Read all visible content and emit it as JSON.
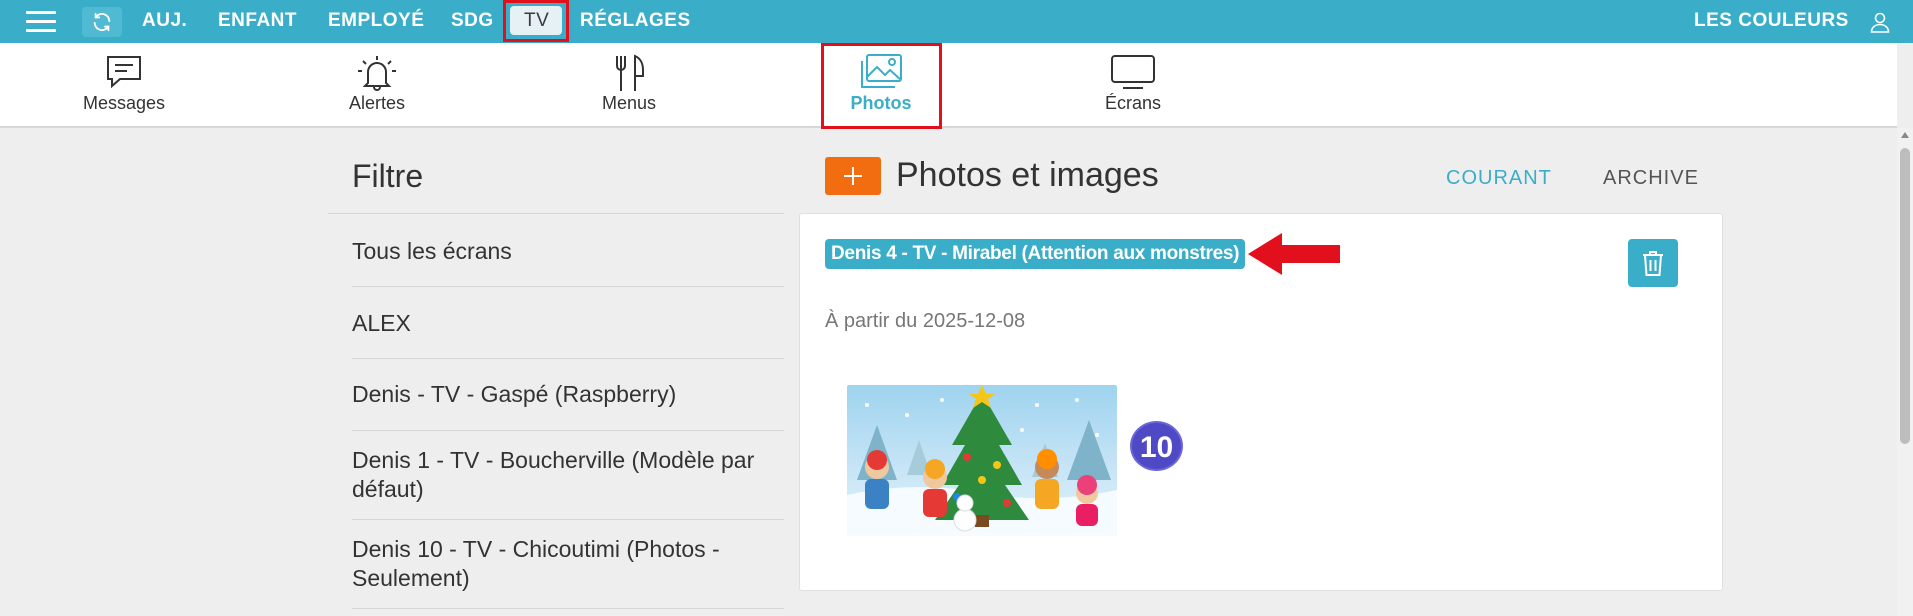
{
  "topnav": {
    "items": [
      "AUJ.",
      "ENFANT",
      "EMPLOYÉ",
      "SDG",
      "TV",
      "RÉGLAGES"
    ],
    "right_label": "LES COULEURS"
  },
  "subnav": {
    "items": [
      {
        "label": "Messages",
        "icon": "message-icon"
      },
      {
        "label": "Alertes",
        "icon": "bell-icon"
      },
      {
        "label": "Menus",
        "icon": "utensils-icon"
      },
      {
        "label": "Photos",
        "icon": "image-icon",
        "active": true
      },
      {
        "label": "Écrans",
        "icon": "monitor-icon"
      }
    ]
  },
  "filter": {
    "title": "Filtre",
    "items": [
      "Tous les écrans",
      "ALEX",
      "Denis - TV - Gaspé (Raspberry)",
      "Denis 1 - TV - Boucherville (Modèle par défaut)",
      "Denis 10 - TV - Chicoutimi (Photos - Seulement)"
    ]
  },
  "main": {
    "add_label": "+",
    "title": "Photos et images",
    "tabs": {
      "current": "COURANT",
      "archive": "ARCHIVE"
    }
  },
  "card": {
    "screen_name": "Denis 4 - TV - Mirabel (Attention aux monstres)",
    "date_text": "À partir du 2025-12-08",
    "count": "10"
  },
  "colors": {
    "primary": "#3aaec8",
    "accent": "#f26d0f",
    "highlight": "#e2101c",
    "badge": "#4f49c5"
  }
}
